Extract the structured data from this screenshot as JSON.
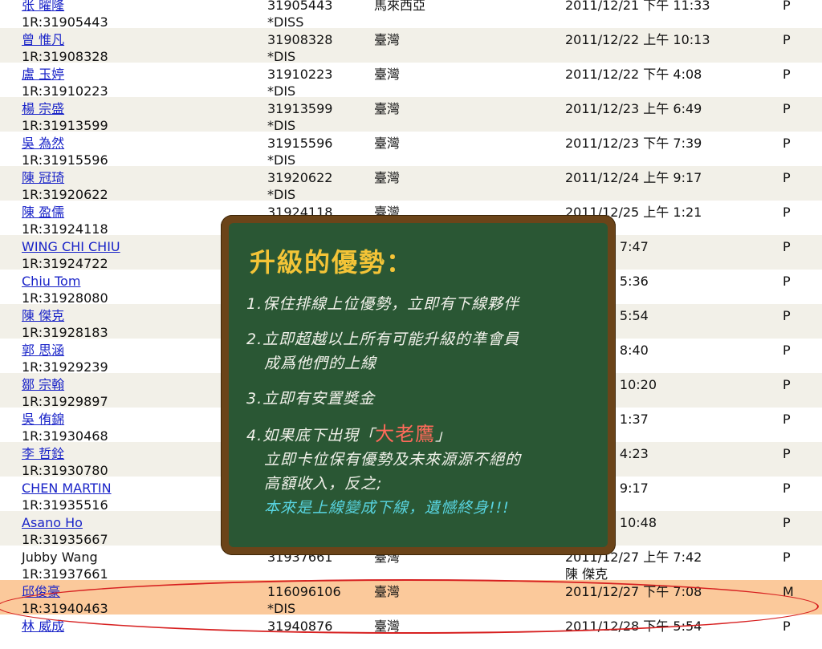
{
  "rows": [
    {
      "name": "张 曜隆",
      "name_link": true,
      "rid": "1R:31905443",
      "id": "31905443",
      "flag": "*DISS",
      "country": "馬來西亞",
      "date": "2011/12/21 下午 11:33",
      "sub": "",
      "status": "P",
      "style": ""
    },
    {
      "name": "曾 惟凡",
      "name_link": true,
      "rid": "1R:31908328",
      "id": "31908328",
      "flag": "*DIS",
      "country": "臺灣",
      "date": "2011/12/22 上午 10:13",
      "sub": "",
      "status": "P",
      "style": "alt"
    },
    {
      "name": "盧 玉婷",
      "name_link": true,
      "rid": "1R:31910223",
      "id": "31910223",
      "flag": "*DIS",
      "country": "臺灣",
      "date": "2011/12/22 下午 4:08",
      "sub": "",
      "status": "P",
      "style": ""
    },
    {
      "name": "楊 宗盛",
      "name_link": true,
      "rid": "1R:31913599",
      "id": "31913599",
      "flag": "*DIS",
      "country": "臺灣",
      "date": "2011/12/23 上午 6:49",
      "sub": "",
      "status": "P",
      "style": "alt"
    },
    {
      "name": "吳 為然",
      "name_link": true,
      "rid": "1R:31915596",
      "id": "31915596",
      "flag": "*DIS",
      "country": "臺灣",
      "date": "2011/12/23 下午 7:39",
      "sub": "",
      "status": "P",
      "style": ""
    },
    {
      "name": "陳 冠琦",
      "name_link": true,
      "rid": "1R:31920622",
      "id": "31920622",
      "flag": "*DIS",
      "country": "臺灣",
      "date": "2011/12/24 上午 9:17",
      "sub": "",
      "status": "P",
      "style": "alt"
    },
    {
      "name": "陳 盈儒",
      "name_link": true,
      "rid": "1R:31924118",
      "id": "31924118",
      "flag": "",
      "country": "臺灣",
      "date": "2011/12/25 上午 1:21",
      "sub": "",
      "status": "P",
      "style": ""
    },
    {
      "name": "WING CHI CHIU",
      "name_link": true,
      "rid": "1R:31924722",
      "id": "",
      "flag": "",
      "country": "",
      "date": "/25 上午 7:47",
      "sub": "",
      "status": "P",
      "style": "alt"
    },
    {
      "name": "Chiu Tom",
      "name_link": true,
      "rid": "1R:31928080",
      "id": "",
      "flag": "",
      "country": "",
      "date": "/25 下午 5:36",
      "sub": "",
      "status": "P",
      "style": ""
    },
    {
      "name": "陳 傑克",
      "name_link": true,
      "rid": "1R:31928183",
      "id": "",
      "flag": "",
      "country": "",
      "date": "/25 下午 5:54",
      "sub": "",
      "status": "P",
      "style": "alt"
    },
    {
      "name": "郭 思涵",
      "name_link": true,
      "rid": "1R:31929239",
      "id": "",
      "flag": "",
      "country": "",
      "date": "/25 下午 8:40",
      "sub": "",
      "status": "P",
      "style": ""
    },
    {
      "name": "鄒 宗翰",
      "name_link": true,
      "rid": "1R:31929897",
      "id": "",
      "flag": "",
      "country": "",
      "date": "/25 下午 10:20",
      "sub": "",
      "status": "P",
      "style": "alt"
    },
    {
      "name": "吳 侑錦",
      "name_link": true,
      "rid": "1R:31930468",
      "id": "",
      "flag": "",
      "country": "",
      "date": "/26 上午 1:37",
      "sub": "",
      "status": "P",
      "style": ""
    },
    {
      "name": "李 哲銓",
      "name_link": true,
      "rid": "1R:31930780",
      "id": "",
      "flag": "",
      "country": "",
      "date": "/26 上午 4:23",
      "sub": "",
      "status": "P",
      "style": "alt"
    },
    {
      "name": "CHEN MARTIN",
      "name_link": true,
      "rid": "1R:31935516",
      "id": "",
      "flag": "",
      "country": "",
      "date": "/26 下午 9:17",
      "sub": "",
      "status": "P",
      "style": ""
    },
    {
      "name": "Asano Ho",
      "name_link": true,
      "rid": "1R:31935667",
      "id": "",
      "flag": "",
      "country": "",
      "date": "/26 下午 10:48",
      "sub": "",
      "status": "P",
      "style": "alt"
    },
    {
      "name": "Jubby Wang",
      "name_link": false,
      "rid": "1R:31937661",
      "id": "31937661",
      "flag": "",
      "country": "臺灣",
      "date": "2011/12/27 上午 7:42",
      "sub": "陳 傑克",
      "status": "P",
      "style": ""
    },
    {
      "name": "邱俊豪",
      "name_link": true,
      "rid": "1R:31940463",
      "id": "116096106",
      "flag": "*DIS",
      "country": "臺灣",
      "date": "2011/12/27 下午 7:08",
      "sub": "",
      "status": "M",
      "style": "hl"
    },
    {
      "name": "林 威成",
      "name_link": true,
      "rid": "",
      "id": "31940876",
      "flag": "",
      "country": "臺灣",
      "date": "2011/12/28 下午 5:54",
      "sub": "",
      "status": "P",
      "style": ""
    }
  ],
  "board": {
    "title": "升級的優勢：",
    "l1": "1.保住排線上位優勢，立即有下線夥伴",
    "l2a": "2.立即超越以上所有可能升級的準會員",
    "l2b": "成爲他們的上線",
    "l3": "3.立即有安置獎金",
    "l4a_pre": "4.如果底下出現「",
    "l4a_em": "大老鷹",
    "l4a_post": "」",
    "l4b": "立即卡位保有優勢及未來源源不絕的",
    "l4c": "高額收入，反之;",
    "l4d": "本來是上線變成下線，遺憾終身!!!"
  }
}
